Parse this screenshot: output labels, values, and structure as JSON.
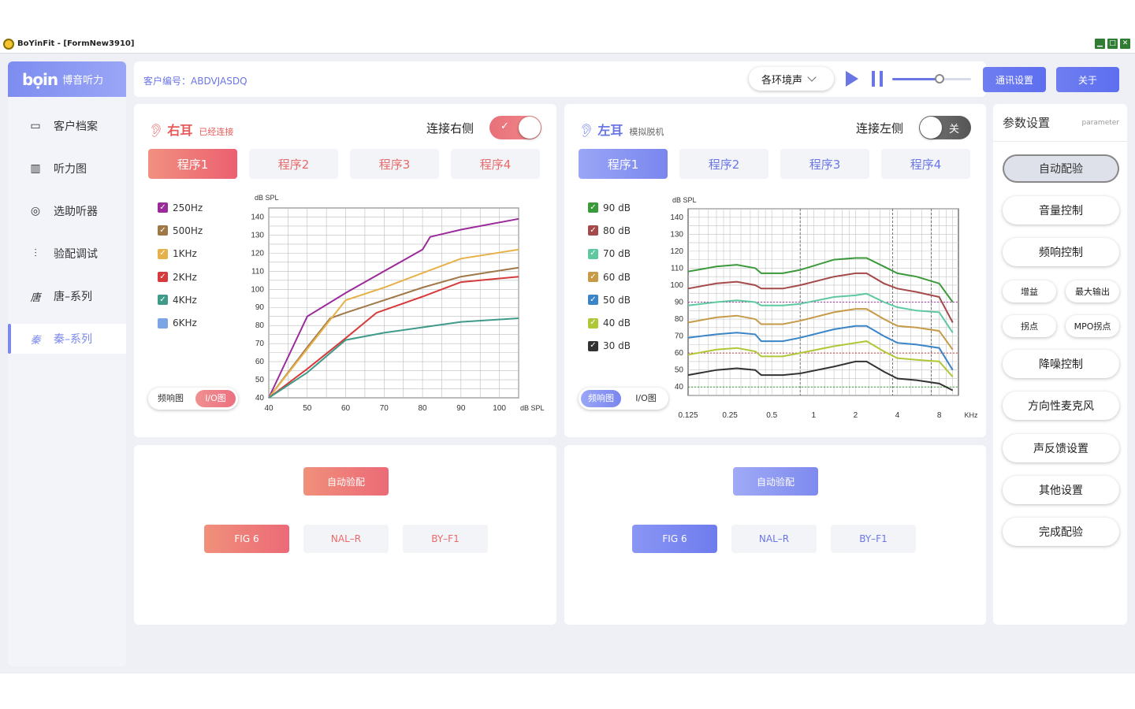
{
  "window": {
    "title": "BoYinFit - [FormNew3910]",
    "min": "▁",
    "max": "□",
    "close": "✕"
  },
  "brand": {
    "logo": "bọin",
    "name": "博音听力"
  },
  "nav": [
    {
      "label": "客户档案",
      "icon": "folder-icon",
      "glyph": "▭"
    },
    {
      "label": "听力图",
      "icon": "bar-chart-icon",
      "glyph": "▥"
    },
    {
      "label": "选助听器",
      "icon": "hearing-aid-icon",
      "glyph": "◎"
    },
    {
      "label": "验配调试",
      "icon": "sliders-icon",
      "glyph": "⫶"
    },
    {
      "label": "唐–系列",
      "icon": "tang-series-icon",
      "glyph": "唐"
    },
    {
      "label": "秦–系列",
      "icon": "qin-series-icon",
      "glyph": "秦"
    }
  ],
  "topbar": {
    "client_id": "客户编号：ABDVJASDQ",
    "env": "各环境声",
    "comm_btn": "通讯设置",
    "about_btn": "关于",
    "volume": 0.6
  },
  "right_ear": {
    "name": "右耳",
    "status": "已经连接",
    "connect_label": "连接右侧",
    "toggle_label": "✓",
    "tabs": [
      "程序1",
      "程序2",
      "程序3",
      "程序4"
    ],
    "legend": [
      {
        "label": "250Hz",
        "color": "#9b2a9b"
      },
      {
        "label": "500Hz",
        "color": "#a07848"
      },
      {
        "label": "1KHz",
        "color": "#e7b14a"
      },
      {
        "label": "2KHz",
        "color": "#d63a3a"
      },
      {
        "label": "4KHz",
        "color": "#3f9a8a"
      },
      {
        "label": "6KHz",
        "color": "#7aa6e6"
      }
    ],
    "view_freq": "频响图",
    "view_io": "I/O图",
    "auto_btn": "自动验配",
    "formulas": [
      "FIG  6",
      "NAL–R",
      "BY–F1"
    ]
  },
  "left_ear": {
    "name": "左耳",
    "status": "模拟脱机",
    "connect_label": "连接左侧",
    "toggle_label": "关",
    "tabs": [
      "程序1",
      "程序2",
      "程序3",
      "程序4"
    ],
    "legend": [
      {
        "label": "90 dB",
        "color": "#3a9a3a"
      },
      {
        "label": "80 dB",
        "color": "#a54a4a"
      },
      {
        "label": "70 dB",
        "color": "#5ec8a0"
      },
      {
        "label": "60 dB",
        "color": "#c79a48"
      },
      {
        "label": "50 dB",
        "color": "#3a84c8"
      },
      {
        "label": "40 dB",
        "color": "#b0c838"
      },
      {
        "label": "30 dB",
        "color": "#333333"
      }
    ],
    "view_freq": "频响图",
    "view_io": "I/O图",
    "auto_btn": "自动验配",
    "formulas": [
      "FIG  6",
      "NAL–R",
      "BY–F1"
    ]
  },
  "params": {
    "title": "参数设置",
    "subtitle": "parameter",
    "buttons": [
      "自动配验",
      "音量控制",
      "频响控制",
      "降噪控制",
      "方向性麦克风",
      "声反馈设置",
      "其他设置",
      "完成配验"
    ],
    "small": [
      "增益",
      "最大输出",
      "拐点",
      "MPO拐点"
    ]
  },
  "chart_data": [
    {
      "type": "line",
      "title": "",
      "ylabel": "dB SPL",
      "xlabel": "dB SPL",
      "xlim": [
        40,
        105
      ],
      "ylim": [
        40,
        145
      ],
      "xticks": [
        40,
        50,
        60,
        70,
        80,
        90,
        100
      ],
      "yticks": [
        40,
        50,
        60,
        70,
        80,
        90,
        100,
        110,
        120,
        130,
        140
      ],
      "series": [
        {
          "name": "250Hz",
          "color": "#9b2a9b",
          "points": [
            [
              40,
              40
            ],
            [
              50,
              85
            ],
            [
              60,
              98
            ],
            [
              70,
              110
            ],
            [
              80,
              122
            ],
            [
              82,
              129
            ],
            [
              90,
              133
            ],
            [
              105,
              139
            ]
          ]
        },
        {
          "name": "500Hz",
          "color": "#a07848",
          "points": [
            [
              40,
              40
            ],
            [
              50,
              68
            ],
            [
              56,
              84
            ],
            [
              60,
              87
            ],
            [
              70,
              94
            ],
            [
              80,
              101
            ],
            [
              90,
              107
            ],
            [
              105,
              112
            ]
          ]
        },
        {
          "name": "1KHz",
          "color": "#e7b14a",
          "points": [
            [
              40,
              40
            ],
            [
              50,
              67
            ],
            [
              60,
              94
            ],
            [
              70,
              101
            ],
            [
              80,
              109
            ],
            [
              90,
              117
            ],
            [
              105,
              122
            ]
          ]
        },
        {
          "name": "2KHz",
          "color": "#d63a3a",
          "points": [
            [
              40,
              40
            ],
            [
              50,
              56
            ],
            [
              60,
              73
            ],
            [
              68,
              87
            ],
            [
              80,
              96
            ],
            [
              90,
              104
            ],
            [
              105,
              107
            ]
          ]
        },
        {
          "name": "4KHz",
          "color": "#3f9a8a",
          "points": [
            [
              40,
              40
            ],
            [
              50,
              54
            ],
            [
              60,
              72
            ],
            [
              70,
              76
            ],
            [
              80,
              79
            ],
            [
              90,
              82
            ],
            [
              105,
              84
            ]
          ]
        }
      ]
    },
    {
      "type": "line",
      "title": "",
      "ylabel": "dB SPL",
      "xlabel": "KHz",
      "xscale": "log",
      "xlim": [
        0.125,
        11
      ],
      "ylim": [
        35,
        145
      ],
      "xticks": [
        "0.125",
        "0.25",
        "0.5",
        "1",
        "2",
        "4",
        "8"
      ],
      "yticks": [
        40,
        50,
        60,
        70,
        80,
        90,
        100,
        110,
        120,
        130,
        140
      ],
      "series": [
        {
          "name": "90 dB",
          "color": "#3a9a3a",
          "points": [
            [
              0.125,
              108
            ],
            [
              0.2,
              111
            ],
            [
              0.28,
              112
            ],
            [
              0.38,
              110
            ],
            [
              0.42,
              107
            ],
            [
              0.6,
              107
            ],
            [
              0.8,
              109
            ],
            [
              1.4,
              115
            ],
            [
              2.0,
              116
            ],
            [
              2.4,
              116
            ],
            [
              3.2,
              111
            ],
            [
              4.0,
              107
            ],
            [
              5.5,
              105
            ],
            [
              8.0,
              101
            ],
            [
              10,
              90
            ]
          ]
        },
        {
          "name": "80 dB",
          "color": "#a54a4a",
          "points": [
            [
              0.125,
              98
            ],
            [
              0.2,
              101
            ],
            [
              0.28,
              102
            ],
            [
              0.38,
              100
            ],
            [
              0.42,
              98
            ],
            [
              0.6,
              98
            ],
            [
              0.8,
              100
            ],
            [
              1.4,
              105
            ],
            [
              2.0,
              107
            ],
            [
              2.4,
              107
            ],
            [
              3.2,
              101
            ],
            [
              4.0,
              98
            ],
            [
              5.5,
              96
            ],
            [
              8.0,
              93
            ],
            [
              10,
              78
            ]
          ]
        },
        {
          "name": "70 dB",
          "color": "#5ec8a0",
          "points": [
            [
              0.125,
              88
            ],
            [
              0.2,
              90
            ],
            [
              0.28,
              91
            ],
            [
              0.38,
              90
            ],
            [
              0.42,
              88
            ],
            [
              0.6,
              88
            ],
            [
              0.8,
              89
            ],
            [
              1.4,
              93
            ],
            [
              2.0,
              94
            ],
            [
              2.4,
              95
            ],
            [
              3.2,
              90
            ],
            [
              4.0,
              87
            ],
            [
              5.5,
              85
            ],
            [
              8.0,
              84
            ],
            [
              10,
              72
            ]
          ]
        },
        {
          "name": "60 dB",
          "color": "#c79a48",
          "points": [
            [
              0.125,
              78
            ],
            [
              0.2,
              81
            ],
            [
              0.28,
              82
            ],
            [
              0.38,
              80
            ],
            [
              0.42,
              77
            ],
            [
              0.6,
              77
            ],
            [
              0.8,
              79
            ],
            [
              1.4,
              84
            ],
            [
              2.0,
              86
            ],
            [
              2.4,
              86
            ],
            [
              3.2,
              80
            ],
            [
              4.0,
              76
            ],
            [
              5.5,
              75
            ],
            [
              8.0,
              73
            ],
            [
              10,
              62
            ]
          ]
        },
        {
          "name": "50 dB",
          "color": "#3a84c8",
          "points": [
            [
              0.125,
              69
            ],
            [
              0.2,
              71
            ],
            [
              0.28,
              72
            ],
            [
              0.38,
              71
            ],
            [
              0.42,
              67
            ],
            [
              0.6,
              67
            ],
            [
              0.8,
              69
            ],
            [
              1.4,
              74
            ],
            [
              2.0,
              76
            ],
            [
              2.4,
              76
            ],
            [
              3.2,
              70
            ],
            [
              4.0,
              66
            ],
            [
              5.5,
              65
            ],
            [
              8.0,
              63
            ],
            [
              10,
              50
            ]
          ]
        },
        {
          "name": "40 dB",
          "color": "#b0c838",
          "points": [
            [
              0.125,
              59
            ],
            [
              0.2,
              62
            ],
            [
              0.28,
              63
            ],
            [
              0.38,
              61
            ],
            [
              0.42,
              58
            ],
            [
              0.6,
              58
            ],
            [
              0.8,
              60
            ],
            [
              1.4,
              64
            ],
            [
              2.0,
              66
            ],
            [
              2.4,
              67
            ],
            [
              3.2,
              61
            ],
            [
              4.0,
              57
            ],
            [
              5.5,
              56
            ],
            [
              8.0,
              55
            ],
            [
              10,
              46
            ]
          ]
        },
        {
          "name": "30 dB",
          "color": "#333333",
          "points": [
            [
              0.125,
              47
            ],
            [
              0.2,
              50
            ],
            [
              0.28,
              51
            ],
            [
              0.38,
              50
            ],
            [
              0.42,
              47
            ],
            [
              0.6,
              47
            ],
            [
              0.8,
              48
            ],
            [
              1.4,
              52
            ],
            [
              2.0,
              55
            ],
            [
              2.4,
              55
            ],
            [
              3.2,
              49
            ],
            [
              4.0,
              45
            ],
            [
              5.5,
              44
            ],
            [
              8.0,
              42
            ],
            [
              10,
              38
            ]
          ]
        }
      ],
      "reference_lines": [
        {
          "y": 90,
          "color": "#a040a0"
        },
        {
          "y": 60,
          "color": "#c04040"
        },
        {
          "y": 40,
          "color": "#3a9a3a"
        }
      ]
    }
  ]
}
